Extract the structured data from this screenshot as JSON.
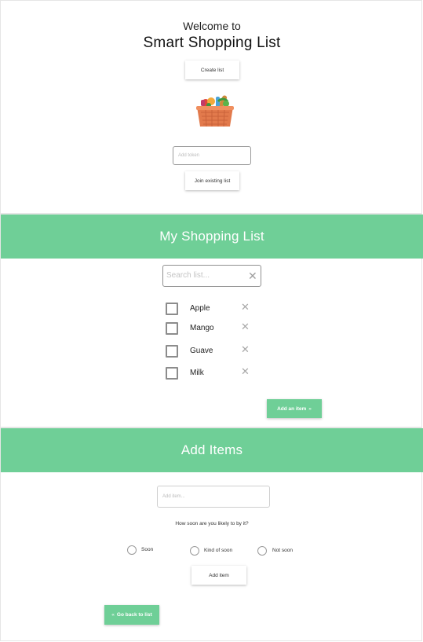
{
  "welcome": {
    "greeting": "Welcome to",
    "app_name": "Smart Shopping List",
    "create_list_label": "Create list",
    "token_placeholder": "Add token",
    "join_list_label": "Join existing list",
    "basket_icon": "grocery-basket-icon"
  },
  "shopping_list": {
    "title": "My Shopping List",
    "search_placeholder": "Search list...",
    "clear_icon": "close-icon",
    "items": [
      {
        "label": "Apple",
        "checked": false
      },
      {
        "label": "Mango",
        "checked": false
      },
      {
        "label": "Guave",
        "checked": false
      },
      {
        "label": "Milk",
        "checked": false
      }
    ],
    "remove_icon": "close-icon",
    "add_item_label": "Add an item",
    "add_item_icon": "double-chevron-right-icon"
  },
  "add_items": {
    "title": "Add Items",
    "item_placeholder": "Add item...",
    "question": "How soon are you likely to by it?",
    "options": [
      {
        "label": "Soon"
      },
      {
        "label": "Kind of soon"
      },
      {
        "label": "Not soon"
      }
    ],
    "submit_label": "Add item",
    "back_label": "Go back to list",
    "back_icon": "double-chevron-left-icon"
  },
  "colors": {
    "accent": "#6fcf97",
    "text": "#222222"
  }
}
